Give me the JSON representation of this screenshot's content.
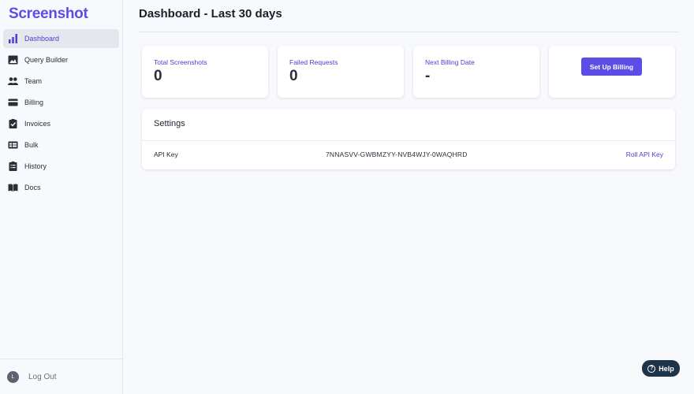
{
  "app": {
    "logo": "Screenshot"
  },
  "sidebar": {
    "items": [
      {
        "label": "Dashboard",
        "icon": "bar-chart-icon",
        "active": true
      },
      {
        "label": "Query Builder",
        "icon": "image-icon"
      },
      {
        "label": "Team",
        "icon": "people-icon"
      },
      {
        "label": "Billing",
        "icon": "credit-card-icon"
      },
      {
        "label": "Invoices",
        "icon": "clipboard-check-icon"
      },
      {
        "label": "Bulk",
        "icon": "table-icon"
      },
      {
        "label": "History",
        "icon": "clipboard-list-icon"
      },
      {
        "label": "Docs",
        "icon": "book-icon"
      }
    ],
    "user_initial": "L",
    "logout_label": "Log Out"
  },
  "main": {
    "title": "Dashboard - Last 30 days",
    "stats": [
      {
        "label": "Total Screenshots",
        "value": "0"
      },
      {
        "label": "Failed Requests",
        "value": "0"
      },
      {
        "label": "Next Billing Date",
        "value": "-"
      }
    ],
    "billing_button": "Set Up Billing",
    "settings": {
      "title": "Settings",
      "api_key_label": "API Key",
      "api_key_value": "7NNASVV-GWBMZYY-NVB4WJY-0WAQHRD",
      "roll_label": "Roll API Key"
    }
  },
  "help": {
    "label": "Help",
    "icon": "question-icon"
  },
  "colors": {
    "accent": "#5b4de6",
    "help_bg": "#1d3347",
    "active_nav_bg": "#e6e7ee"
  }
}
